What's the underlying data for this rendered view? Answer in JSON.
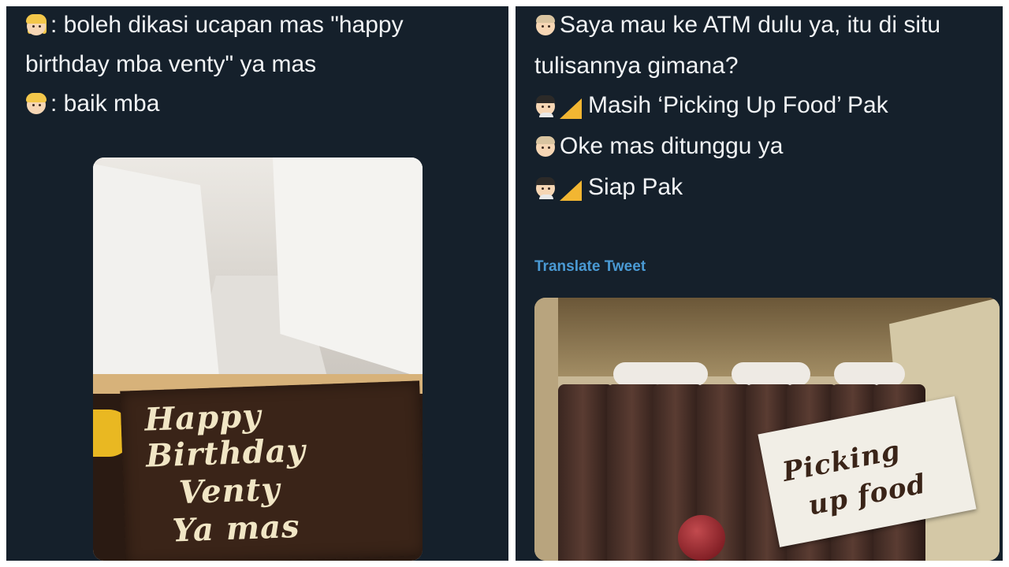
{
  "left_post": {
    "lines": [
      {
        "emoji": "girl-emoji",
        "text": ": boleh dikasi ucapan mas  \"happy"
      },
      {
        "emoji": null,
        "text": "birthday mba venty\" ya mas"
      },
      {
        "emoji": "boy-emoji",
        "text": ": baik mba"
      }
    ],
    "photo": {
      "plaque_lines": [
        "Happy",
        "Birthday",
        "Venty",
        "Ya mas"
      ]
    }
  },
  "right_post": {
    "lines": [
      {
        "emoji": "man-emoji",
        "text": "Saya mau ke ATM dulu ya, itu di situ"
      },
      {
        "emoji": null,
        "text": "tulisannya gimana?"
      },
      {
        "emoji": "courier-emoji",
        "text": " Masih ‘Picking Up Food’ Pak"
      },
      {
        "emoji": "man-emoji",
        "text": "Oke mas ditunggu ya"
      },
      {
        "emoji": "courier-emoji",
        "text": " Siap Pak"
      }
    ],
    "translate_label": "Translate Tweet",
    "photo": {
      "plaque_lines": [
        "Picking",
        "up food"
      ]
    }
  },
  "colors": {
    "panel_bg": "#15202b",
    "text": "#f1f3f5",
    "link": "#4a9ad4"
  }
}
